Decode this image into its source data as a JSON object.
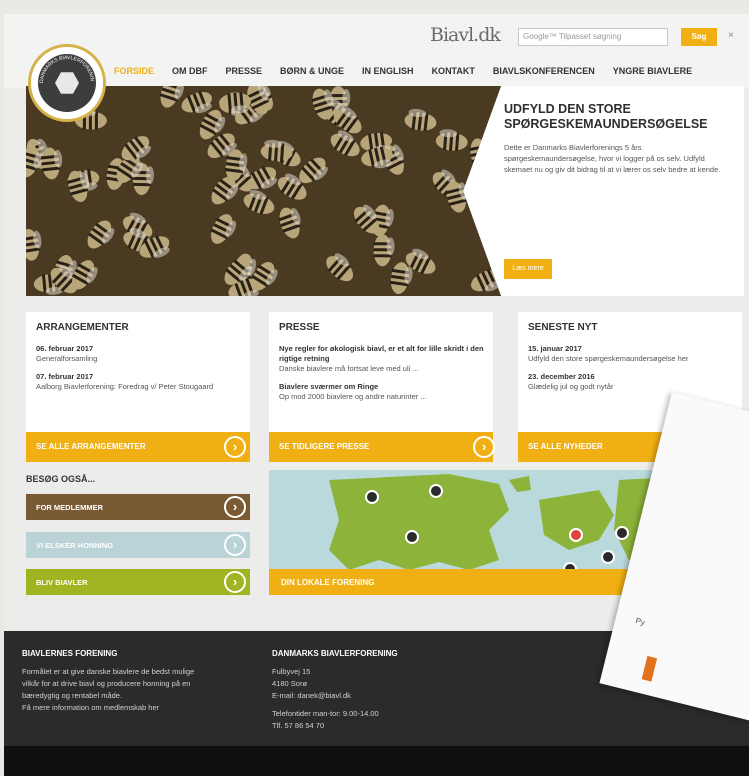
{
  "header": {
    "brand": "Biavl.dk",
    "search_placeholder": "Google™ Tilpasset søgning",
    "search_button": "Søg",
    "close_symbol": "×",
    "logo_text": "DANMARKS BIAVLERFORENING"
  },
  "nav": [
    "FORSIDE",
    "OM DBF",
    "PRESSE",
    "BØRN & UNGE",
    "IN ENGLISH",
    "KONTAKT",
    "BIAVLSKONFERENCEN",
    "YNGRE BIAVLERE"
  ],
  "hero": {
    "title": "UDFYLD DEN STORE SPØRGESKEMAUNDERSØGELSE",
    "body": "Dette er Danmarks Biavlerforenings 5 års spørgeskemaundersøgelse, hvor vi logger på os selv. Udfyld skemaet nu og giv dit bidrag til at vi lærer os selv bedre at kende.",
    "button": "Læs mere"
  },
  "cards": [
    {
      "title": "ARRANGEMENTER",
      "items": [
        {
          "title": "06. februar 2017",
          "desc": "Generalforsamling"
        },
        {
          "title": "07. februar 2017",
          "desc": "Aalborg Biavlerforening: Foredrag v/ Peter Stougaard"
        }
      ],
      "footer": "SE ALLE ARRANGEMENTER"
    },
    {
      "title": "PRESSE",
      "items": [
        {
          "title": "Nye regler for økologisk biavl, er et alt for lille skridt i den rigtige retning",
          "desc": "Danske biavlere må fortsat leve med uli ..."
        },
        {
          "title": "Biavlere sværmer om Ringe",
          "desc": "Op mod 2000 biavlere og andre naturinter ..."
        }
      ],
      "footer": "SE TIDLIGERE PRESSE"
    },
    {
      "title": "SENESTE NYT",
      "items": [
        {
          "title": "15. januar 2017",
          "desc": "Udfyld den store spørgeskemaundersøgelse her"
        },
        {
          "title": "23. december 2016",
          "desc": "Glædelig jul og godt nytår"
        }
      ],
      "footer": "SE ALLE NYHEDER"
    }
  ],
  "visit": {
    "label": "BESØG OGSÅ...",
    "buttons": [
      {
        "label": "FOR MEDLEMMER",
        "color": "#7a5a32"
      },
      {
        "label": "VI ELSKER HONNING",
        "color": "#b9d3d6"
      },
      {
        "label": "BLIV BIAVLER",
        "color": "#9fb420"
      }
    ]
  },
  "map": {
    "footer": "DIN LOKALE FORENING"
  },
  "footer": {
    "col1": {
      "title": "BIAVLERNES FORENING",
      "lines": [
        "Formålet er at give danske biavlere de bedst mulige",
        "vilkår for at drive biavl og producere honning på en",
        "bæredygtig og rentabel måde.",
        "Få mere information om medlemskab her"
      ]
    },
    "col2": {
      "title": "DANMARKS BIAVLERFORENING",
      "lines": [
        "Fulbyvej 15",
        "4180 Sorø",
        "E-mail: danek@biavl.dk",
        "",
        "Telefontider man-tor: 9.00-14.00",
        "Tlf. 57 86 54 70"
      ]
    }
  },
  "overlay": {
    "text": "Py"
  },
  "colors": {
    "accent": "#f0b013",
    "dark": "#2b2b2b"
  }
}
